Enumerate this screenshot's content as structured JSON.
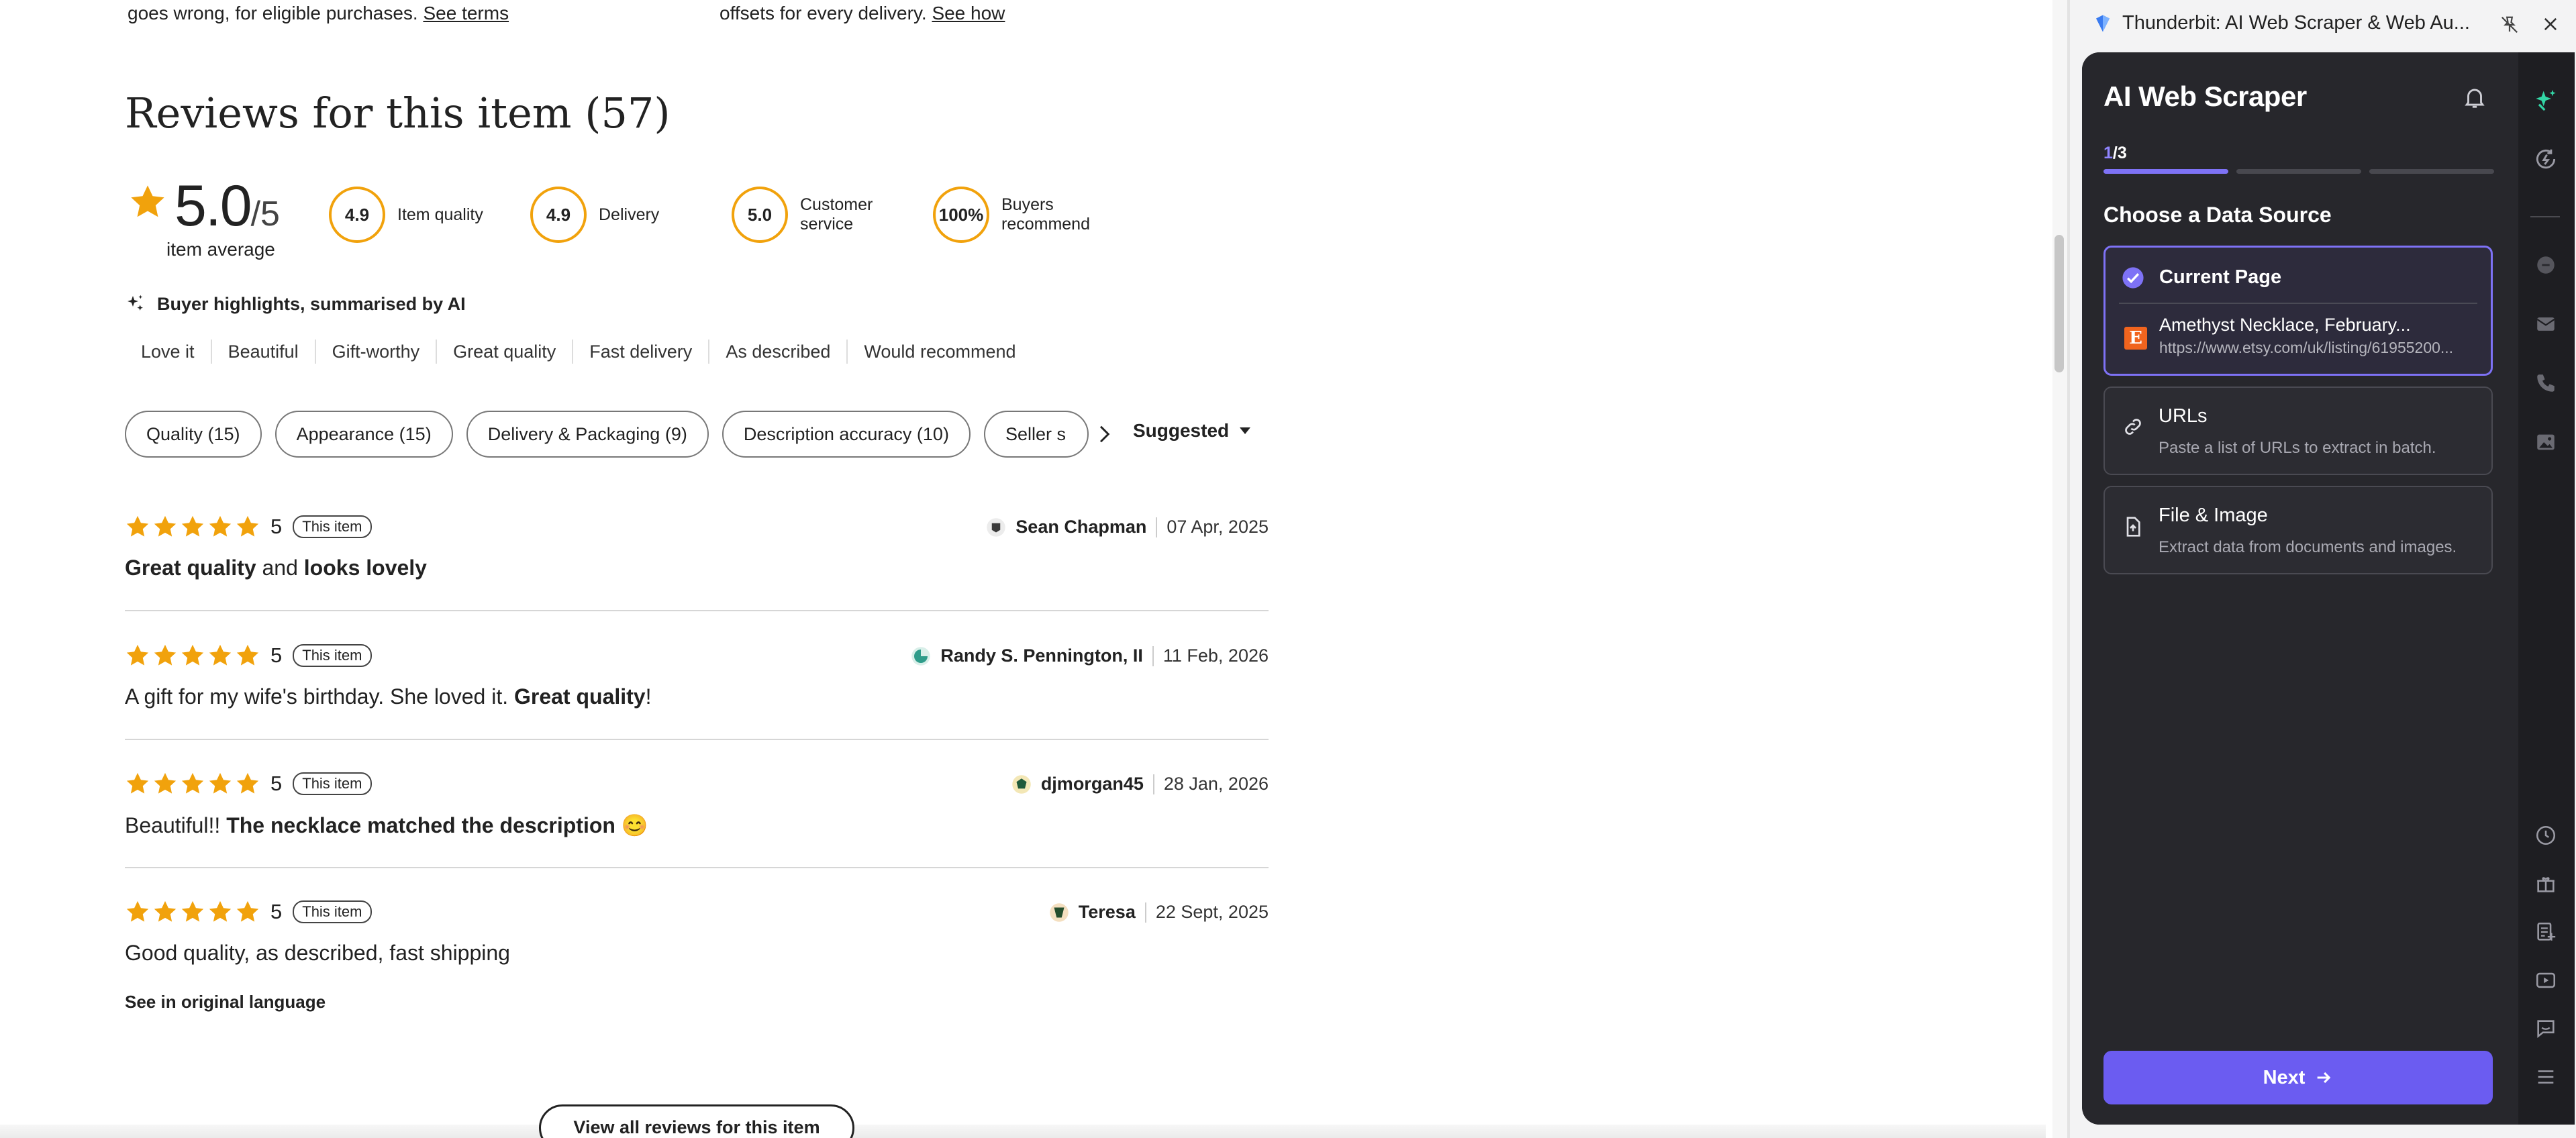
{
  "top": {
    "left_text": "goes wrong, for eligible purchases.",
    "left_link": "See terms",
    "right_text": "offsets for every delivery.",
    "right_link": "See how"
  },
  "reviews": {
    "title": "Reviews for this item (57)",
    "average": "5.0",
    "average_suffix": "/5",
    "average_caption": "item average",
    "metrics": [
      {
        "value": "4.9",
        "label_line1": "Item quality",
        "label_line2": ""
      },
      {
        "value": "4.9",
        "label_line1": "Delivery",
        "label_line2": ""
      },
      {
        "value": "5.0",
        "label_line1": "Customer",
        "label_line2": "service"
      },
      {
        "value": "100%",
        "label_line1": "Buyers",
        "label_line2": "recommend"
      }
    ],
    "highlights_title": "Buyer highlights, summarised by AI",
    "highlights": [
      "Love it",
      "Beautiful",
      "Gift-worthy",
      "Great quality",
      "Fast delivery",
      "As described",
      "Would recommend"
    ],
    "filters": [
      "Quality (15)",
      "Appearance (15)",
      "Delivery & Packaging (9)",
      "Description accuracy (10)",
      "Seller s"
    ],
    "sort_label": "Suggested",
    "items": [
      {
        "rating": "5",
        "badge": "This item",
        "reviewer": "Sean Chapman",
        "date": "07 Apr, 2025",
        "parts": [
          {
            "t": "Great quality",
            "b": true
          },
          {
            "t": " and ",
            "b": false
          },
          {
            "t": "looks lovely",
            "b": true
          }
        ]
      },
      {
        "rating": "5",
        "badge": "This item",
        "reviewer": "Randy S. Pennington, II",
        "date": "11 Feb, 2026",
        "parts": [
          {
            "t": "A gift for my wife's birthday. She loved it. ",
            "b": false
          },
          {
            "t": "Great quality",
            "b": true
          },
          {
            "t": "!",
            "b": false
          }
        ]
      },
      {
        "rating": "5",
        "badge": "This item",
        "reviewer": "djmorgan45",
        "date": "28 Jan, 2026",
        "parts": [
          {
            "t": "Beautiful!! ",
            "b": false
          },
          {
            "t": "The necklace matched the description",
            "b": true
          },
          {
            "t": " 😊",
            "b": false
          }
        ]
      },
      {
        "rating": "5",
        "badge": "This item",
        "reviewer": "Teresa",
        "date": "22 Sept, 2025",
        "parts": [
          {
            "t": "Good quality, as described, fast shipping",
            "b": false
          }
        ]
      }
    ],
    "see_original": "See in original language",
    "view_all": "View all reviews for this item"
  },
  "extension": {
    "window_title": "Thunderbit: AI Web Scraper & Web Au...",
    "app_title": "AI Web Scraper",
    "step_current": "1",
    "step_total": "/3",
    "section_title": "Choose a Data Source",
    "current_page": {
      "title": "Current Page",
      "page_name": "Amethyst Necklace, February...",
      "page_url": "https://www.etsy.com/uk/listing/61955200..."
    },
    "urls": {
      "title": "URLs",
      "subtitle": "Paste a list of URLs to extract in batch."
    },
    "file_image": {
      "title": "File & Image",
      "subtitle": "Extract data from documents and images."
    },
    "next_label": "Next",
    "colors": {
      "accent": "#7e72f6",
      "button": "#6b5cf1",
      "panel": "#27272c",
      "star": "#f1a20c",
      "etsy": "#f1641e"
    }
  }
}
